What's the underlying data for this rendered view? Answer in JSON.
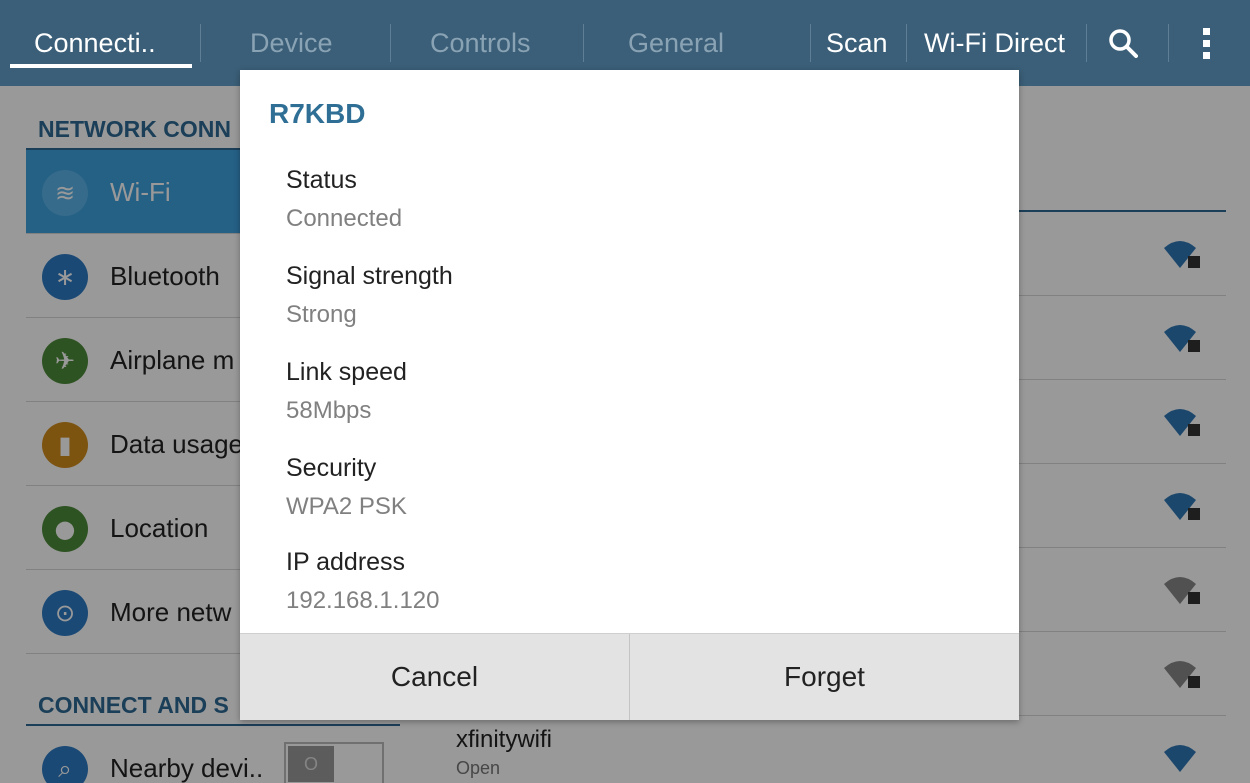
{
  "tabs": [
    {
      "label": "Connecti..",
      "active": true
    },
    {
      "label": "Device",
      "active": false
    },
    {
      "label": "Controls",
      "active": false
    },
    {
      "label": "General",
      "active": false
    }
  ],
  "actions": {
    "scan": "Scan",
    "wifi_direct": "Wi-Fi Direct"
  },
  "sidebar": {
    "section1": "NETWORK CONN",
    "items": [
      {
        "label": "Wi-Fi",
        "icon": "wifi-icon",
        "color": "#3ea0de"
      },
      {
        "label": "Bluetooth",
        "icon": "bluetooth-icon",
        "color": "#2d7bc4"
      },
      {
        "label": "Airplane m",
        "icon": "airplane-icon",
        "color": "#4e8a3a"
      },
      {
        "label": "Data usage",
        "icon": "data-usage-icon",
        "color": "#d08a1c"
      },
      {
        "label": "Location",
        "icon": "location-icon",
        "color": "#4e8a3a"
      },
      {
        "label": "More netw",
        "icon": "more-networks-icon",
        "color": "#2d7bc4"
      }
    ],
    "section2": "CONNECT AND S",
    "nearby": {
      "label": "Nearby devi..",
      "icon": "nearby-devices-icon",
      "toggle": "O"
    }
  },
  "networks": {
    "last": {
      "name": "xfinitywifi",
      "sub": "Open"
    }
  },
  "dialog": {
    "title": "R7KBD",
    "fields": [
      {
        "label": "Status",
        "value": "Connected"
      },
      {
        "label": "Signal strength",
        "value": "Strong"
      },
      {
        "label": "Link speed",
        "value": "58Mbps"
      },
      {
        "label": "Security",
        "value": "WPA2 PSK"
      },
      {
        "label": "IP address",
        "value": "192.168.1.120"
      }
    ],
    "cancel": "Cancel",
    "forget": "Forget"
  },
  "colors": {
    "topbar": "#3b5f78",
    "accent": "#2f6f96"
  }
}
